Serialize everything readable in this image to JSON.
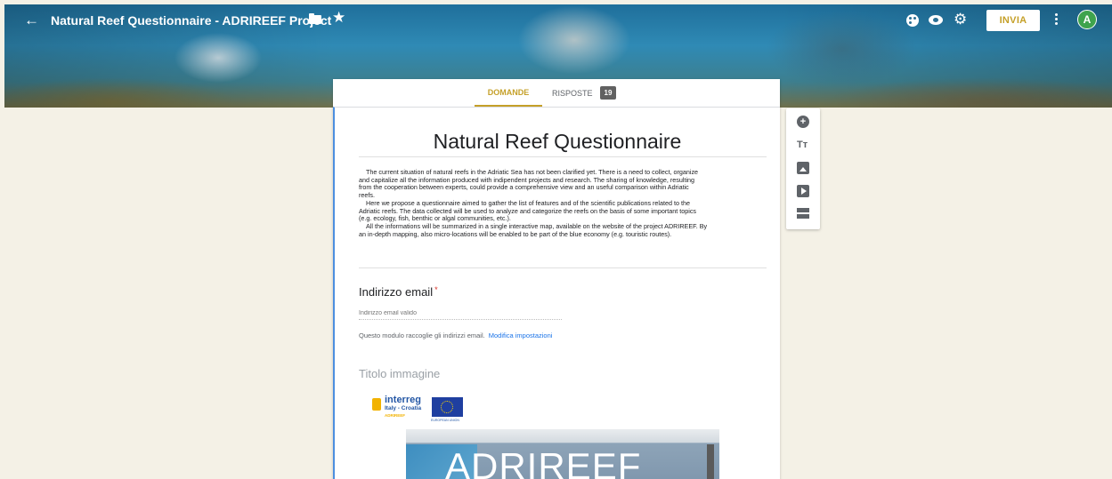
{
  "header": {
    "title": "Natural Reef Questionnaire - ADRIREEF Project",
    "send_label": "INVIA",
    "avatar_initial": "A",
    "icons": [
      "back-icon",
      "folder-icon",
      "star-icon",
      "palette-icon",
      "eye-icon",
      "gear-icon",
      "more-vert-icon"
    ]
  },
  "tabs": {
    "questions": "DOMANDE",
    "responses": "RISPOSTE",
    "responses_count": "19"
  },
  "form": {
    "title": "Natural Reef Questionnaire",
    "description": "    The current situation of natural reefs in the Adriatic Sea has not been clarified yet. There is a need to collect, organize\nand capitalize all the information produced with indipendent projects and research. The sharing of knowledge, resulting\nfrom the cooperation between experts, could provide a comprehensive view and an useful comparison within Adriatic\nreefs.\n    Here we propose a questionnaire aimed to gather the list of features and of the scientific publications related to the\nAdriatic reefs. The data collected will be used to analyze and categorize the reefs on the basis of some important topics\n(e.g. ecology, fish, benthic or algal communities, etc.).\n    All the informations will be summarized in a single interactive map, available on the website of the project ADRIREEF. By\nan in-depth mapping, also micro-locations will be enabled to be part of the blue economy (e.g. touristic routes).",
    "email_label": "Indirizzo email",
    "required_mark": "*",
    "email_placeholder": "Indirizzo email valido",
    "email_note": "Questo modulo raccoglie gli indirizzi email.",
    "settings_link": "Modifica impostazioni",
    "image_title": "Titolo immagine"
  },
  "logo": {
    "interreg": "interreg",
    "region": "Italy - Croatia",
    "project": "ADRIREEF",
    "eu_caption": "EUROPEAN UNION"
  },
  "banner_image": {
    "text": "ADRIREEF"
  },
  "toolbar": {
    "text_icon_label": "Tт",
    "add_icon_label": "+"
  },
  "colors": {
    "accent": "#c5a029",
    "avatar": "#3fa34d",
    "focus_bar": "#4d8fdf",
    "link": "#1a73e8",
    "background": "#f4f1e6"
  }
}
